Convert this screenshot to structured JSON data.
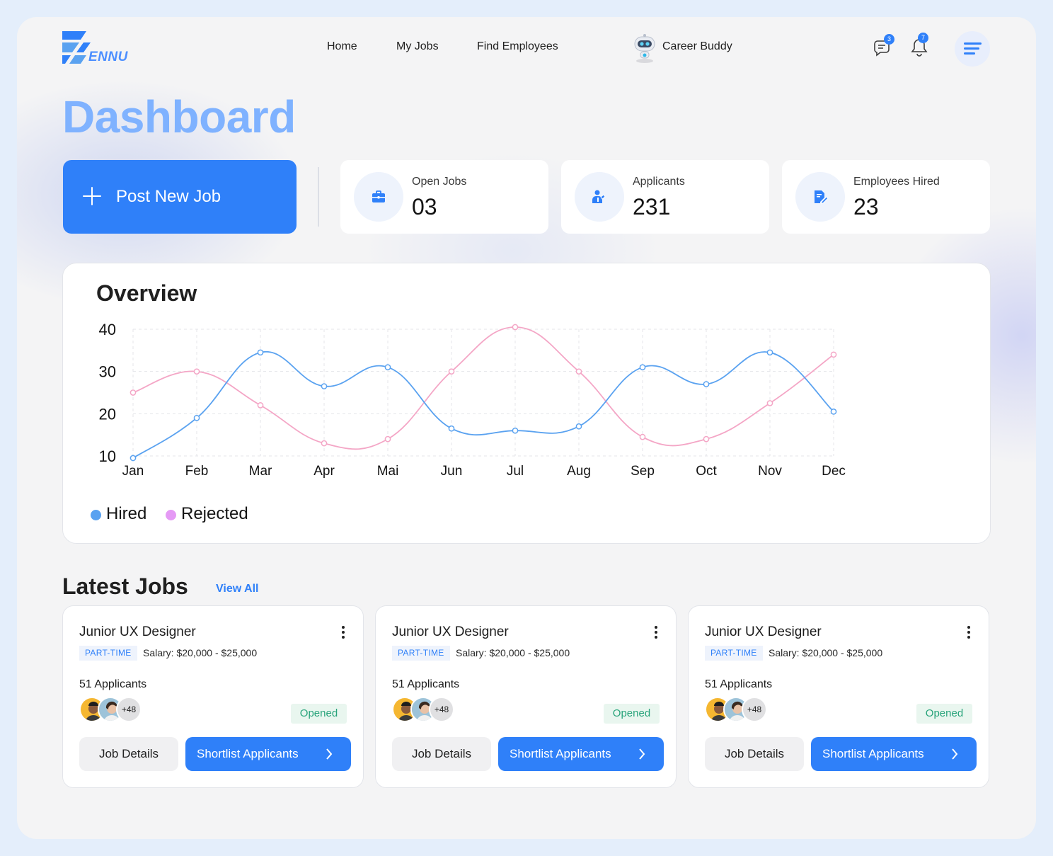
{
  "app": {
    "logo_text": "ENNU"
  },
  "nav": {
    "items": [
      {
        "label": "Home"
      },
      {
        "label": "My Jobs"
      },
      {
        "label": "Find Employees"
      }
    ],
    "career_buddy": "Career Buddy"
  },
  "header": {
    "messages_badge": "3",
    "notifications_badge": "7",
    "icons": [
      "chat-icon",
      "bell-icon",
      "hamburger-menu-icon"
    ]
  },
  "page_title": "Dashboard",
  "post_job_label": "Post New Job",
  "stats": [
    {
      "label": "Open Jobs",
      "value": "03",
      "icon": "briefcase-icon"
    },
    {
      "label": "Applicants",
      "value": "231",
      "icon": "applicant-icon"
    },
    {
      "label": "Employees Hired",
      "value": "23",
      "icon": "document-edit-icon"
    }
  ],
  "overview": {
    "title": "Overview",
    "chart_data": {
      "type": "line",
      "categories": [
        "Jan",
        "Feb",
        "Mar",
        "Apr",
        "Mai",
        "Jun",
        "Jul",
        "Aug",
        "Sep",
        "Oct",
        "Nov",
        "Dec"
      ],
      "y_ticks": [
        "40",
        "30",
        "20",
        "10"
      ],
      "ylim": [
        10,
        40
      ],
      "grid": true,
      "legend_position": "bottom-left",
      "series": [
        {
          "name": "Hired",
          "color": "#5aa2f0",
          "values": [
            9.5,
            19,
            34.5,
            26.5,
            31,
            16.5,
            16,
            17,
            31,
            27,
            34.5,
            20.5
          ]
        },
        {
          "name": "Rejected",
          "color": "#f4a6c6",
          "values": [
            25,
            30,
            22,
            13,
            14,
            30,
            40.5,
            30,
            14.5,
            14,
            22.5,
            34
          ]
        }
      ]
    },
    "legend": [
      {
        "name": "Hired",
        "color": "#5aa2f0"
      },
      {
        "name": "Rejected",
        "color": "#e59af5"
      }
    ]
  },
  "latest_jobs": {
    "title": "Latest Jobs",
    "view_all": "View All",
    "jobs": [
      {
        "title": "Junior UX Designer",
        "type": "PART-TIME",
        "salary": "Salary: $20,000 - $25,000",
        "applicants": "51 Applicants",
        "more": "+48",
        "status": "Opened",
        "details_label": "Job Details",
        "shortlist_label": "Shortlist Applicants"
      },
      {
        "title": "Junior UX Designer",
        "type": "PART-TIME",
        "salary": "Salary: $20,000 - $25,000",
        "applicants": "51 Applicants",
        "more": "+48",
        "status": "Opened",
        "details_label": "Job Details",
        "shortlist_label": "Shortlist Applicants"
      },
      {
        "title": "Junior UX Designer",
        "type": "PART-TIME",
        "salary": "Salary: $20,000 - $25,000",
        "applicants": "51 Applicants",
        "more": "+48",
        "status": "Opened",
        "details_label": "Job Details",
        "shortlist_label": "Shortlist Applicants"
      }
    ]
  }
}
